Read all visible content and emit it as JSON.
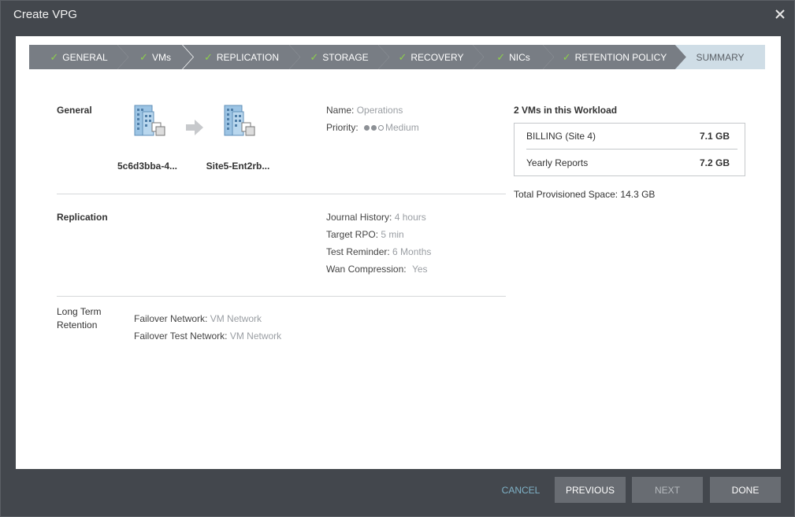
{
  "window": {
    "title": "Create VPG"
  },
  "wizard": {
    "steps": [
      {
        "label": "GENERAL",
        "done": true
      },
      {
        "label": "VMs",
        "done": true
      },
      {
        "label": "REPLICATION",
        "done": true
      },
      {
        "label": "STORAGE",
        "done": true
      },
      {
        "label": "RECOVERY",
        "done": true
      },
      {
        "label": "NICs",
        "done": true
      },
      {
        "label": "RETENTION POLICY",
        "done": true
      },
      {
        "label": "SUMMARY",
        "done": false,
        "active": true
      }
    ],
    "check_glyph": "✓"
  },
  "general": {
    "heading": "General",
    "source_site": "5c6d3bba-4...",
    "target_site": "Site5-Ent2rb...",
    "name_label": "Name:",
    "name_value": "Operations",
    "priority_label": "Priority:",
    "priority_value": "Medium",
    "priority_level": 2,
    "priority_max": 3
  },
  "replication": {
    "heading": "Replication",
    "journal_label": "Journal History:",
    "journal_value": "4 hours",
    "rpo_label": "Target RPO:",
    "rpo_value": "5 min",
    "reminder_label": "Test Reminder:",
    "reminder_value": "6 Months",
    "wan_label": "Wan Compression:",
    "wan_value": "Yes"
  },
  "retention": {
    "heading_line1": "Long Term",
    "heading_line2": "Retention",
    "failover_label": "Failover Network:",
    "failover_value": "VM Network",
    "test_label": "Failover Test Network:",
    "test_value": "VM Network"
  },
  "workload": {
    "heading": "2 VMs in this Workload",
    "vms": [
      {
        "name": "BILLING (Site 4)",
        "size": "7.1 GB"
      },
      {
        "name": "Yearly Reports",
        "size": "7.2 GB"
      }
    ],
    "total": "Total Provisioned Space: 14.3 GB"
  },
  "footer": {
    "cancel": "CANCEL",
    "previous": "PREVIOUS",
    "next": "NEXT",
    "done": "DONE"
  },
  "colors": {
    "step_bg": "#787d84",
    "step_active_bg": "#cfdde6",
    "check": "#8ed04b",
    "link": "#7fb2c7"
  }
}
